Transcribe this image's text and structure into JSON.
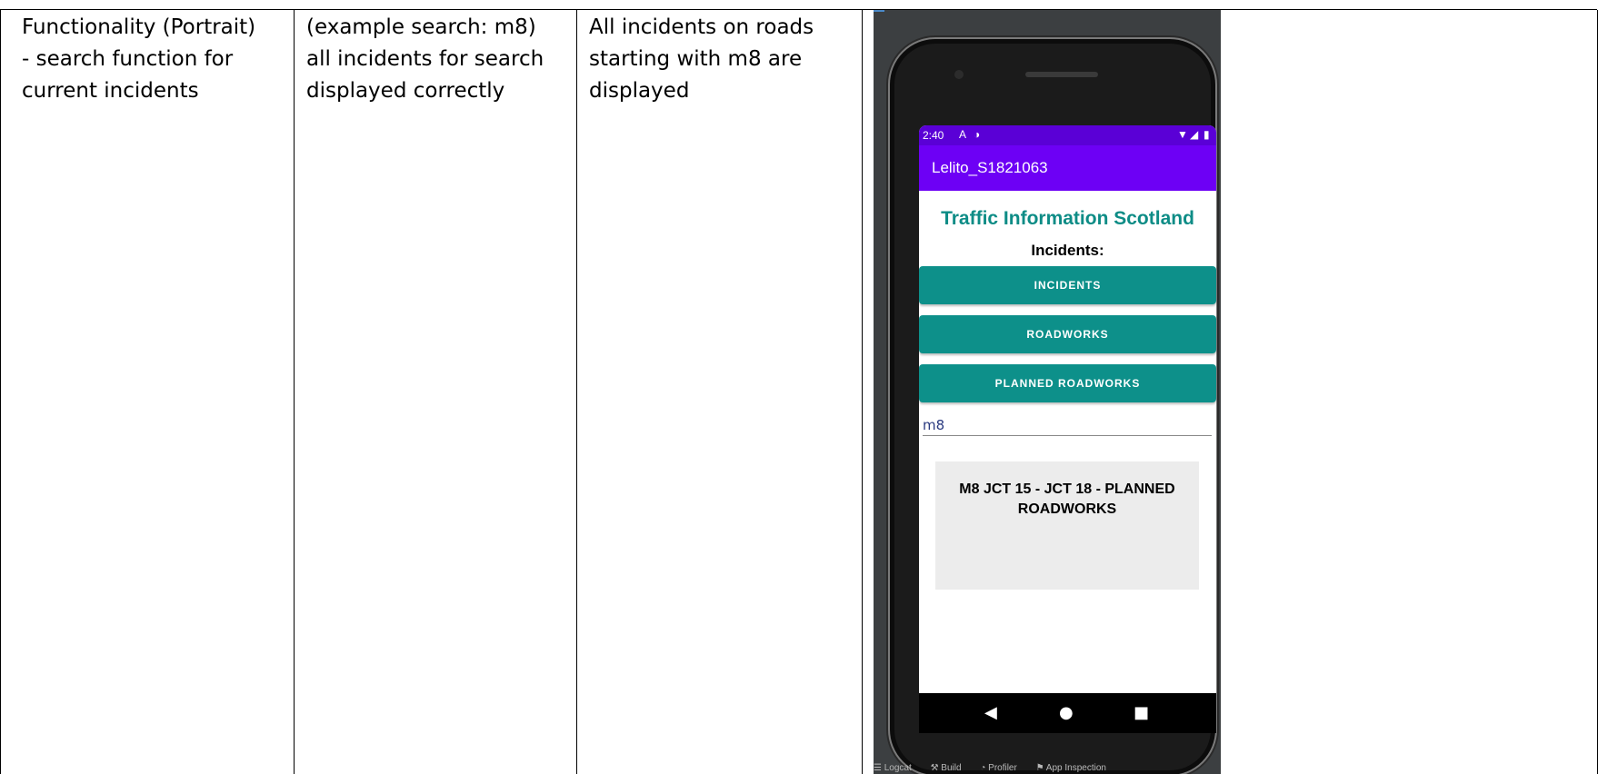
{
  "table": {
    "row": {
      "functionality": "Functionality (Portrait)\n- search function for\ncurrent incidents",
      "test": "(example search: m8)\nall incidents for search\ndisplayed correctly",
      "expected": "All incidents on roads\nstarting with m8 are\ndisplayed"
    }
  },
  "phone": {
    "status_time": "2:40",
    "status_icons_left": [
      "A",
      "◑"
    ],
    "status_icons_right": [
      "▼",
      "◢",
      "▮"
    ],
    "app_title": "Lelito_S1821063",
    "heading": "Traffic Information Scotland",
    "subheading": "Incidents:",
    "buttons": {
      "incidents": "INCIDENTS",
      "roadworks": "ROADWORKS",
      "planned": "PLANNED ROADWORKS"
    },
    "search_value": "m8",
    "result": "M8 JCT 15 - JCT 18 - PLANNED\nROADWORKS",
    "nav": {
      "back": "◀",
      "home": "●",
      "recent": "■"
    },
    "colors": {
      "status_bar": "#5a00d6",
      "app_bar": "#6d00f5",
      "accent": "#0d908a",
      "heading": "#0d8c86"
    }
  },
  "ide": {
    "items": [
      "☰ Logcat",
      "⚒ Build",
      "◔ Profiler",
      "⚑ App Inspection"
    ]
  }
}
